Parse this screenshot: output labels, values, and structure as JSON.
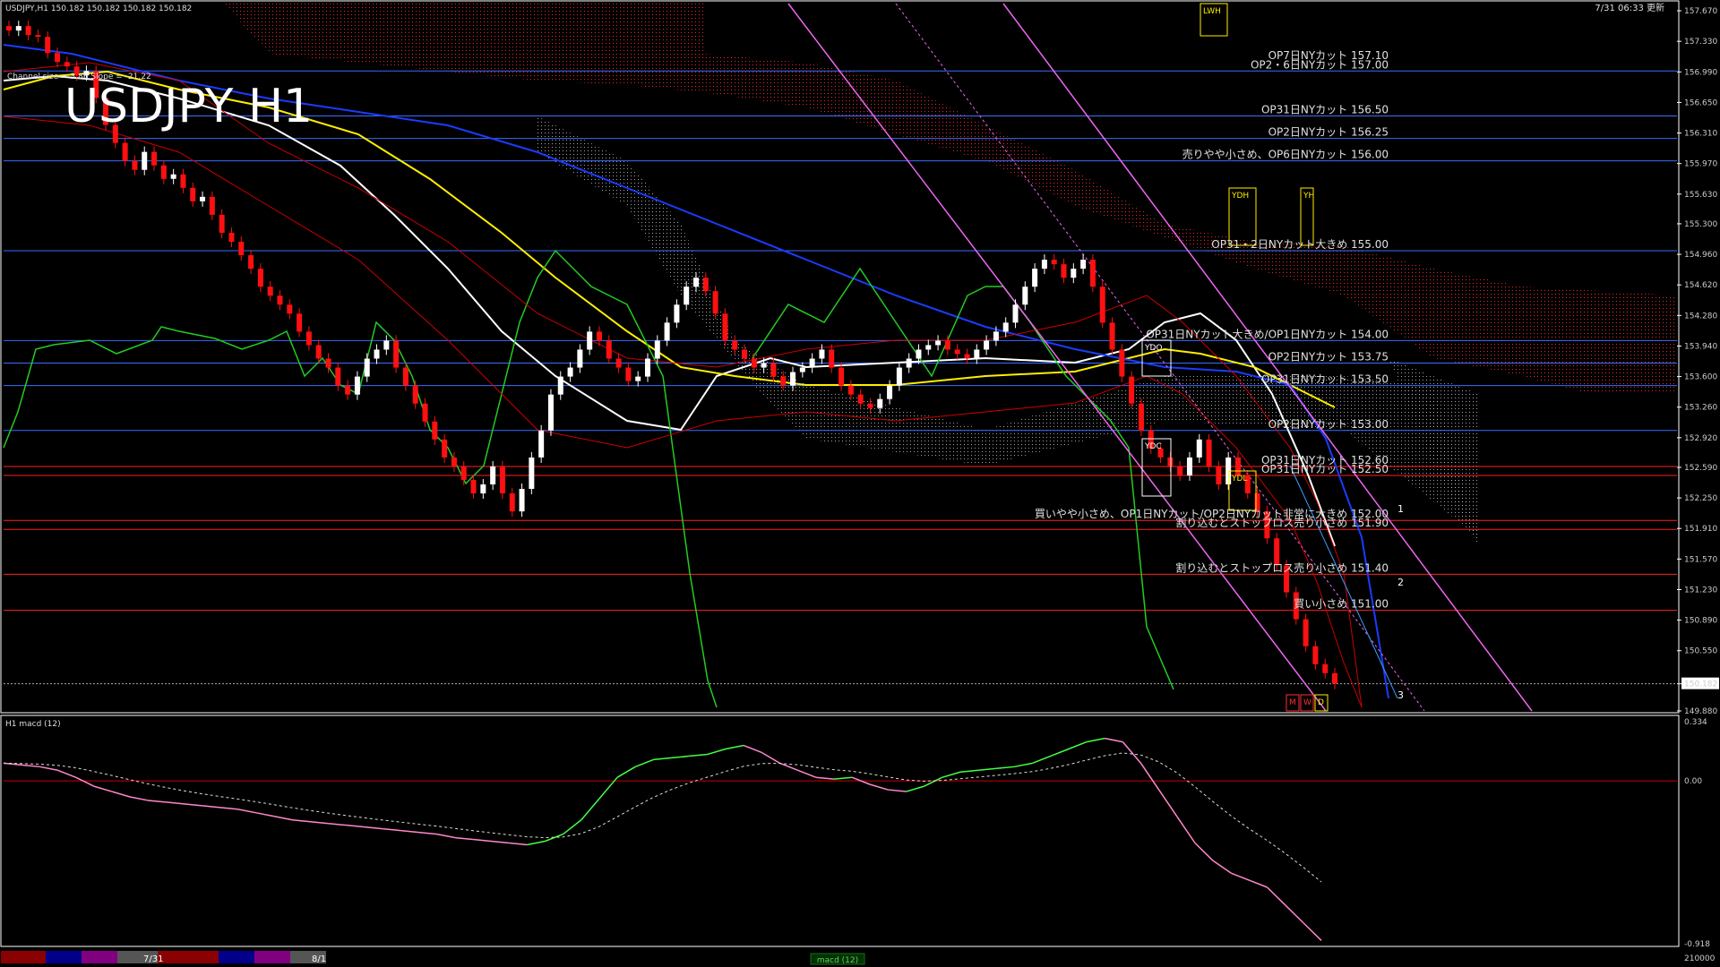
{
  "header": {
    "symbol_info": "USDJPY,H1  150.182 150.182 150.182 150.182",
    "timestamp": "7/31 06:33 更新",
    "watermark": "USDJPY H1",
    "channel_info": "Channel size = 3.86 Slope = -21.22"
  },
  "main_axis": {
    "ylim": [
      149.88,
      157.75
    ],
    "ticks": [
      "157.670",
      "157.330",
      "156.990",
      "156.650",
      "156.310",
      "155.970",
      "155.630",
      "155.300",
      "154.960",
      "154.620",
      "154.280",
      "153.940",
      "153.600",
      "153.260",
      "152.920",
      "152.590",
      "152.250",
      "151.910",
      "151.570",
      "151.230",
      "150.890",
      "150.550",
      "150.182",
      "149.880"
    ],
    "current_price": "150.182"
  },
  "macd": {
    "label": "H1  macd (12)",
    "ticks": [
      "0.334",
      "0.00",
      "-0.918",
      "210000"
    ],
    "ylim": [
      -0.918,
      0.334
    ],
    "tab_label": "macd (12)"
  },
  "bottom_axis": {
    "dates": [
      "7/31",
      "8/1"
    ]
  },
  "colors": {
    "background": "#000000",
    "bull_candle": "#ffffff",
    "bear_candle": "#ff1010",
    "cloud": "#ff3030",
    "blue_level": "#3a6cff",
    "red_level": "#ff2020",
    "ma_white": "#ffffff",
    "ma_yellow": "#ffee00",
    "ma_blue": "#1a3cff",
    "chikou": "#22cc22",
    "channel": "#ee66ee",
    "macd_up": "#44ff44",
    "macd_down": "#ff88cc",
    "text": "#e0e0e0"
  },
  "annotations": [
    {
      "text": "OP7日NYカット 157.10",
      "price": 157.1
    },
    {
      "text": "OP2・6日NYカット 157.00",
      "price": 157.0
    },
    {
      "text": "OP31日NYカット 156.50",
      "price": 156.5
    },
    {
      "text": "OP2日NYカット 156.25",
      "price": 156.25
    },
    {
      "text": "売りやや小さめ、OP6日NYカット 156.00",
      "price": 156.0
    },
    {
      "text": "OP31・2日NYカット大きめ 155.00",
      "price": 155.0
    },
    {
      "text": "OP31日NYカット大きめ/OP1日NYカット 154.00",
      "price": 154.0
    },
    {
      "text": "OP2日NYカット 153.75",
      "price": 153.75
    },
    {
      "text": "OP31日NYカット 153.50",
      "price": 153.5
    },
    {
      "text": "OP2日NYカット 153.00",
      "price": 153.0
    },
    {
      "text": "OP31日NYカット 152.60",
      "price": 152.6
    },
    {
      "text": "OP31日NYカット 152.50",
      "price": 152.5
    },
    {
      "text": "買いやや小さめ、OP1日NYカット/OP2日NYカット非常に大きめ 152.00",
      "price": 152.0
    },
    {
      "text": "割り込むとストップロス売り小さめ 151.90",
      "price": 151.9
    },
    {
      "text": "割り込むとストップロス売り小さめ 151.40",
      "price": 151.4
    },
    {
      "text": "買い小さめ 151.00",
      "price": 151.0
    }
  ],
  "box_labels": {
    "lwh": "LWH",
    "ydh": "YDH",
    "yh": "YH",
    "ydo": "YDO",
    "ydc": "YDC",
    "ydl": "YDL",
    "m": "M",
    "w": "W",
    "d": "D"
  },
  "channel_markers": [
    "1",
    "2",
    "3"
  ],
  "chart_data": {
    "type": "candlestick",
    "symbol": "USDJPY",
    "timeframe": "H1",
    "ylim": [
      149.88,
      157.75
    ],
    "candles_close": [
      157.45,
      157.5,
      157.4,
      157.38,
      157.2,
      157.1,
      157.05,
      156.95,
      157.0,
      156.7,
      156.4,
      156.2,
      156.0,
      155.9,
      156.1,
      155.95,
      155.8,
      155.85,
      155.7,
      155.55,
      155.6,
      155.4,
      155.2,
      155.1,
      154.95,
      154.8,
      154.6,
      154.5,
      154.4,
      154.3,
      154.1,
      153.95,
      153.8,
      153.7,
      153.5,
      153.4,
      153.6,
      153.8,
      153.9,
      154.0,
      153.7,
      153.5,
      153.3,
      153.1,
      152.9,
      152.7,
      152.6,
      152.45,
      152.3,
      152.4,
      152.6,
      152.3,
      152.1,
      152.35,
      152.7,
      153.0,
      153.4,
      153.6,
      153.7,
      153.9,
      154.1,
      154.0,
      153.8,
      153.7,
      153.55,
      153.6,
      153.8,
      154.0,
      154.2,
      154.4,
      154.6,
      154.7,
      154.55,
      154.3,
      154.0,
      153.9,
      153.8,
      153.7,
      153.75,
      153.6,
      153.5,
      153.65,
      153.7,
      153.8,
      153.9,
      153.7,
      153.5,
      153.4,
      153.3,
      153.25,
      153.35,
      153.5,
      153.7,
      153.8,
      153.9,
      153.95,
      154.0,
      153.9,
      153.85,
      153.8,
      153.9,
      154.0,
      154.1,
      154.2,
      154.4,
      154.6,
      154.8,
      154.9,
      154.85,
      154.7,
      154.8,
      154.9,
      154.6,
      154.2,
      153.9,
      153.6,
      153.3,
      153.0,
      152.8,
      152.7,
      152.6,
      152.5,
      152.7,
      152.9,
      152.6,
      152.4,
      152.7,
      152.5,
      152.3,
      152.1,
      151.8,
      151.5,
      151.2,
      150.9,
      150.6,
      150.4,
      150.3,
      150.182
    ],
    "annotation_prices": [
      157.1,
      157.0,
      156.5,
      156.25,
      156.0,
      155.0,
      154.0,
      153.75,
      153.5,
      153.0,
      152.6,
      152.5,
      152.0,
      151.9,
      151.4,
      151.0
    ],
    "macd_main": [
      0.1,
      0.09,
      0.08,
      0.06,
      0.02,
      -0.03,
      -0.06,
      -0.09,
      -0.11,
      -0.12,
      -0.13,
      -0.14,
      -0.15,
      -0.16,
      -0.18,
      -0.2,
      -0.22,
      -0.23,
      -0.24,
      -0.25,
      -0.26,
      -0.27,
      -0.28,
      -0.29,
      -0.3,
      -0.32,
      -0.33,
      -0.34,
      -0.35,
      -0.36,
      -0.34,
      -0.3,
      -0.22,
      -0.1,
      0.02,
      0.08,
      0.12,
      0.13,
      0.14,
      0.15,
      0.18,
      0.2,
      0.16,
      0.1,
      0.06,
      0.02,
      0.01,
      0.02,
      -0.02,
      -0.05,
      -0.06,
      -0.03,
      0.02,
      0.05,
      0.06,
      0.07,
      0.08,
      0.1,
      0.14,
      0.18,
      0.22,
      0.24,
      0.22,
      0.1,
      -0.05,
      -0.2,
      -0.35,
      -0.45,
      -0.52,
      -0.56,
      -0.6,
      -0.7,
      -0.8,
      -0.9
    ],
    "xlabel": "",
    "ylabel": ""
  }
}
